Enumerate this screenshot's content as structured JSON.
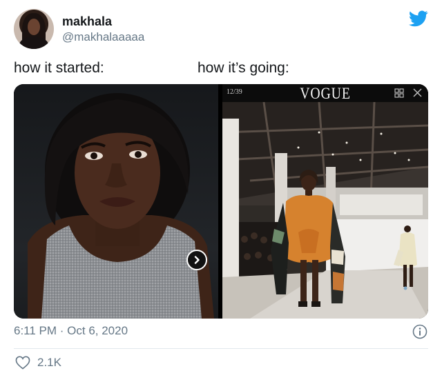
{
  "author": {
    "name": "makhala",
    "handle": "@makhalaaaaa"
  },
  "captions": {
    "left": "how it started:",
    "right": "how it’s going:"
  },
  "media": {
    "left_photo": "portrait",
    "right_photo": {
      "counter": "12/39",
      "brand": "VOGUE"
    },
    "next_icon": "chevron-right-icon"
  },
  "footer": {
    "timestamp": "6:11 PM · Oct 6, 2020",
    "likes": "2.1K"
  },
  "colors": {
    "twitter_blue": "#1da1f2",
    "secondary_text": "#657786",
    "divider": "#e1e8ed"
  }
}
